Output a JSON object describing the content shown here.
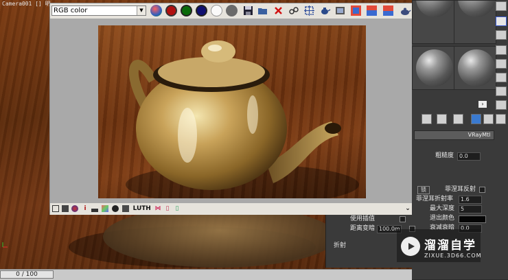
{
  "viewport": {
    "label": "Camera001 [] 明",
    "timeline": "0 / 100"
  },
  "frame_buffer": {
    "channel": "RGB color",
    "toolbar_icons": [
      "rgb-channel-icon",
      "red-channel-icon",
      "green-channel-icon",
      "blue-channel-icon",
      "alpha-channel-icon",
      "monochrome-icon",
      "save-icon",
      "open-icon",
      "clear-icon",
      "track-mouse-icon",
      "region-render-icon",
      "render-teapot-icon",
      "color-correction-icon",
      "srgb-icon",
      "ab-compare-a-icon",
      "ab-compare-b-icon",
      "render-icon"
    ],
    "bottom_icons": [
      "show-pixel-info-icon",
      "lut-settings-icon",
      "history-icon",
      "info-icon",
      "levels-icon",
      "color-balance-icon",
      "exposure-icon",
      "lens-effects-icon"
    ],
    "bottom_labels": {
      "info": "i",
      "lut": "LUT",
      "h": "H"
    },
    "colors": {
      "red": "#b01010",
      "green": "#0a6a0a",
      "blue": "#101070"
    }
  },
  "material_editor": {
    "material_type": "VRayMtl",
    "params": {
      "roughness_label": "粗糙度",
      "roughness_value": "0.0",
      "lock_label": "锁",
      "fresnel_reflect_label": "菲涅耳反射",
      "fresnel_ior_label": "菲涅耳折射率",
      "fresnel_ior_value": "1.6",
      "max_depth_label": "最大深度",
      "max_depth_value": "5",
      "exit_color_label": "退出颜色",
      "use_interp_label": "使用插值",
      "distance_dim_label": "距离变暗",
      "distance_dim_value": "100.0m",
      "dim_falloff_label": "衰减衰暗",
      "dim_falloff_value": "0.0",
      "refraction_label": "折射"
    }
  },
  "watermark": {
    "title": "溜溜自学",
    "url": "ZIXUE.3D66.COM"
  }
}
